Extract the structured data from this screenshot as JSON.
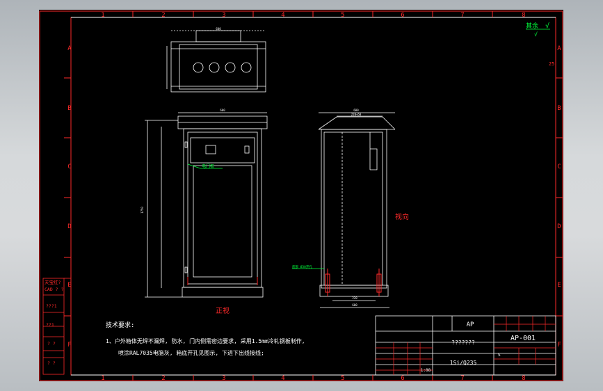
{
  "drawing": {
    "column_numbers": [
      "1",
      "2",
      "3",
      "4",
      "5",
      "6",
      "7",
      "8"
    ],
    "row_letters": [
      "A",
      "B",
      "C",
      "D",
      "E",
      "F"
    ],
    "corner_mark_top": "25",
    "roughness_label": "其余",
    "top_right_symbol": "√"
  },
  "views": {
    "front_view_label": "正视",
    "side_view_label": "视向",
    "top_dim": "600",
    "front_dim_width": "600",
    "front_dim_height": "1750",
    "side_dim_top": "600",
    "side_dim_top2": "220+50",
    "side_dim_bottom": "600",
    "side_dim_small": "220",
    "callout_green": "电门柜",
    "callout_side_green": "底部 Ø30开孔"
  },
  "notes": {
    "title": "技术要求:",
    "line1": "1、户外箱体无焊不漏焊, 防水, 门内侧需密边要求, 采用1.5mm冷轧钢板制作,",
    "line2": "喷涂RAL7035电脑灰, 箱底开孔见图示, 下进下出线接线;"
  },
  "left_margin": {
    "cells": [
      "天宝红?",
      "CAD ? ?",
      "???1",
      "??1",
      "? ?",
      "? ?"
    ]
  },
  "title_block": {
    "code_header": "AP",
    "name_center": "???????",
    "material": "1Si/Q235",
    "drawing_no": "AP-001",
    "scale": "1:08",
    "small_label": "S"
  }
}
